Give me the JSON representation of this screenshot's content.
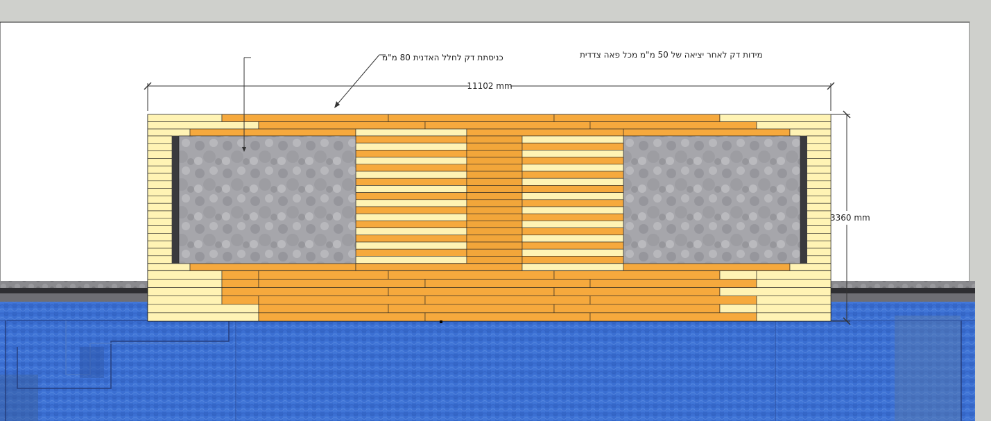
{
  "annotations": {
    "deck_overhang_note": "מידות דק לאחר יציאה של 50 מ\"מ מכל פאה צדדית",
    "deck_inset_note": "כניסתת דק לחלל האדנית 80 מ\"מ"
  },
  "dimensions": {
    "width_label": "11102 mm",
    "height_label": "3360 mm"
  },
  "colors": {
    "background": "#cfd0cc",
    "sheet": "#ffffff",
    "board_light": "#fff3b4",
    "board_dark": "#f6a93d",
    "board_mid": "#f2a63a",
    "stone": "#a9a9ad",
    "water": "#3d72d4",
    "dimension_line": "#333333"
  },
  "icons": {
    "dimension_tick": "diagonal-tick-mark",
    "leader_arrow": "arrow-head"
  }
}
